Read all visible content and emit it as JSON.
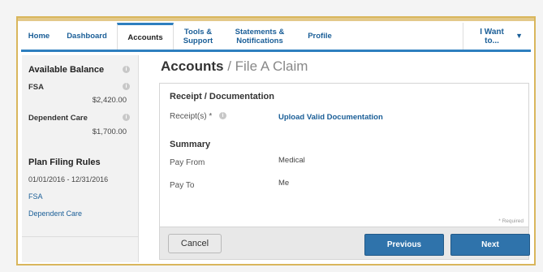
{
  "nav": {
    "home": "Home",
    "dashboard": "Dashboard",
    "accounts": "Accounts",
    "tools_line1": "Tools &",
    "tools_line2": "Support",
    "statements_line1": "Statements &",
    "statements_line2": "Notifications",
    "profile": "Profile",
    "i_want_to": "I Want to..."
  },
  "sidebar": {
    "available_balance": "Available Balance",
    "fsa_label": "FSA",
    "fsa_amount": "$2,420.00",
    "dependent_care_label": "Dependent Care",
    "dependent_care_amount": "$1,700.00",
    "plan_filing_rules": "Plan Filing Rules",
    "date_range": "01/01/2016 - 12/31/2016",
    "link_fsa": "FSA",
    "link_dependent_care": "Dependent Care"
  },
  "page": {
    "title": "Accounts",
    "separator_subtitle": "/ File A Claim"
  },
  "form": {
    "receipt_section": "Receipt / Documentation",
    "receipts_label": "Receipt(s) *",
    "upload_link": "Upload Valid Documentation",
    "summary_section": "Summary",
    "pay_from_label": "Pay From",
    "pay_from_value": "Medical",
    "pay_to_label": "Pay To",
    "pay_to_value": "Me",
    "required_note": "* Required"
  },
  "buttons": {
    "cancel": "Cancel",
    "previous": "Previous",
    "next": "Next"
  },
  "icons": {
    "info": "info-icon",
    "dropdown": "caret-down-icon"
  },
  "colors": {
    "accent": "#2e7fbf",
    "link": "#1a5e97",
    "primary_button": "#2f73ab",
    "frame_border": "#d9b65c"
  }
}
